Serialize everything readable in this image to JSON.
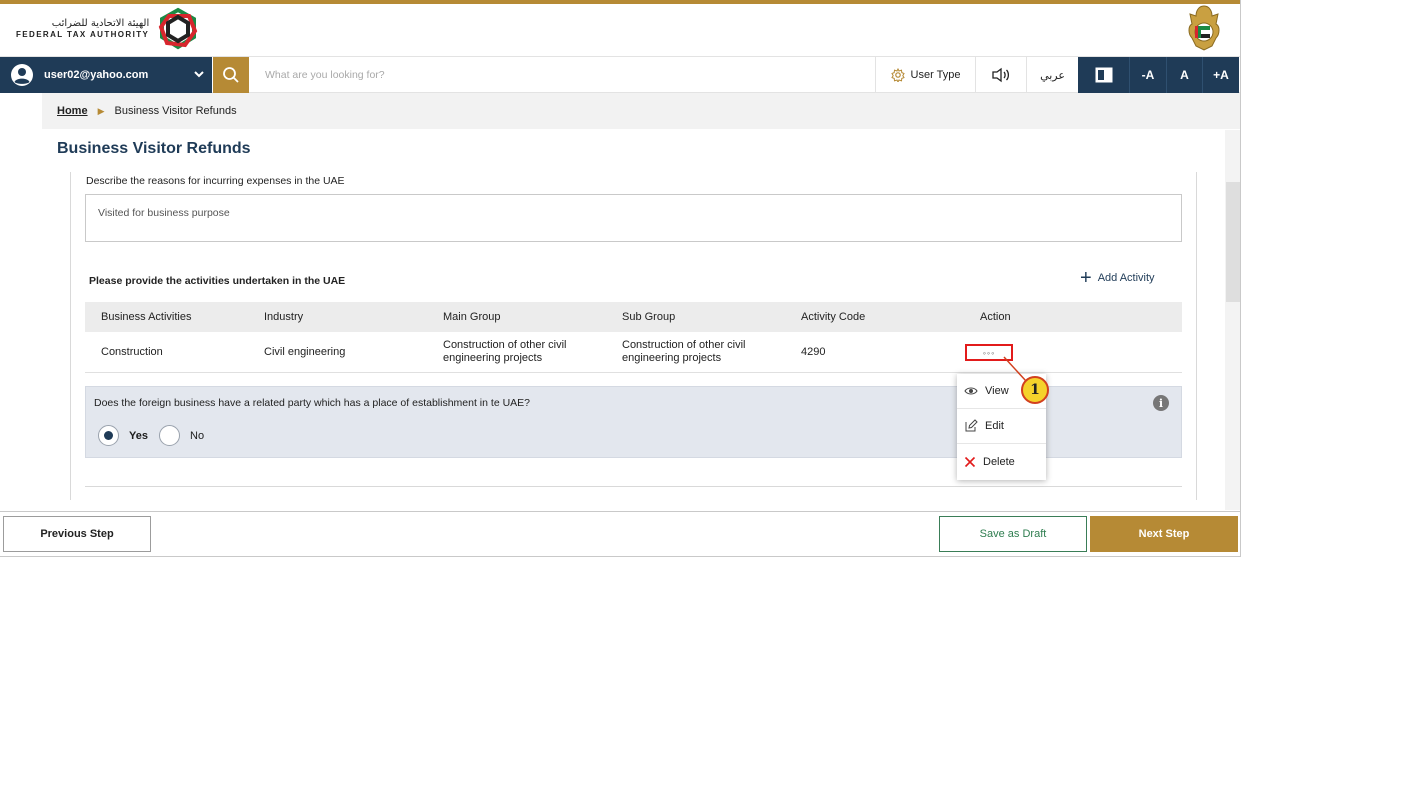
{
  "header": {
    "logo_ar": "الهيئة الاتحادية للضرائب",
    "logo_en": "FEDERAL TAX AUTHORITY",
    "emblem_icon": "uae-emblem-icon",
    "brand_gold": "#b68a35",
    "brand_navy": "#1f3b57"
  },
  "topbar": {
    "user_email": "user02@yahoo.com",
    "search_placeholder": "What are you looking for?",
    "user_type_label": "User Type",
    "language_label": "عربي",
    "font_smaller": "-A",
    "font_normal": "A",
    "font_larger": "+A"
  },
  "breadcrumb": {
    "home": "Home",
    "current": "Business Visitor Refunds"
  },
  "page": {
    "title": "Business Visitor Refunds",
    "reasons_label": "Describe the reasons for incurring expenses in the UAE",
    "reasons_value": "Visited for business purpose",
    "activities_label": "Please provide the activities undertaken in the UAE",
    "add_activity": "Add Activity"
  },
  "table": {
    "headers": [
      "Business Activities",
      "Industry",
      "Main Group",
      "Sub Group",
      "Activity Code",
      "Action"
    ],
    "rows": [
      {
        "business_activity": "Construction",
        "industry": "Civil engineering",
        "main_group": "Construction of other civil engineering projects",
        "sub_group": "Construction of other civil engineering projects",
        "activity_code": "4290",
        "action": "◦◦◦"
      }
    ]
  },
  "question": {
    "text": "Does the foreign business have a related party which has a place of establishment in te UAE?",
    "yes": "Yes",
    "no": "No",
    "selected": "Yes"
  },
  "action_menu": {
    "view": "View",
    "edit": "Edit",
    "delete": "Delete"
  },
  "callout": {
    "number": "1"
  },
  "footer": {
    "previous": "Previous Step",
    "save_draft": "Save as Draft",
    "next": "Next Step"
  }
}
